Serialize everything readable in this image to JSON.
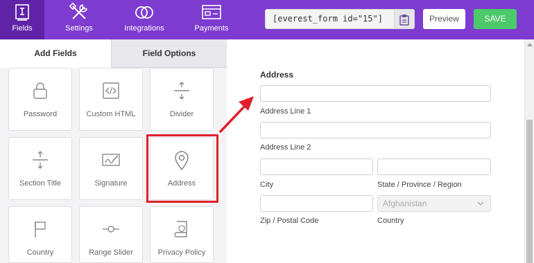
{
  "topbar": {
    "nav": [
      {
        "label": "Fields",
        "icon": "fields-icon"
      },
      {
        "label": "Settings",
        "icon": "tools-icon"
      },
      {
        "label": "Integrations",
        "icon": "integrations-icon"
      },
      {
        "label": "Payments",
        "icon": "payments-icon"
      }
    ],
    "shortcode": "[everest_form id=\"15\"]",
    "copy_icon": "clipboard-icon",
    "preview_label": "Preview",
    "save_label": "SAVE"
  },
  "sidebar": {
    "tabs": [
      {
        "label": "Add Fields",
        "active": true
      },
      {
        "label": "Field Options",
        "active": false
      }
    ],
    "fields": [
      {
        "label": "Password",
        "icon": "lock-icon"
      },
      {
        "label": "Custom HTML",
        "icon": "code-icon"
      },
      {
        "label": "Divider",
        "icon": "divider-icon"
      },
      {
        "label": "Section Title",
        "icon": "section-title-icon"
      },
      {
        "label": "Signature",
        "icon": "signature-icon"
      },
      {
        "label": "Address",
        "icon": "map-pin-icon",
        "highlighted": true
      },
      {
        "label": "Country",
        "icon": "flag-icon"
      },
      {
        "label": "Range Slider",
        "icon": "range-slider-icon"
      },
      {
        "label": "Privacy Policy",
        "icon": "privacy-policy-icon"
      }
    ]
  },
  "form": {
    "title": "Address",
    "fields": {
      "line1_label": "Address Line 1",
      "line2_label": "Address Line 2",
      "city_label": "City",
      "state_label": "State / Province / Region",
      "zip_label": "Zip / Postal Code",
      "country_label": "Country",
      "country_value": "Afghanistan"
    }
  },
  "colors": {
    "topbar": "#7e3bd0",
    "active_nav": "#5f23a8",
    "save": "#4cc96b",
    "highlight": "#e0202a"
  }
}
